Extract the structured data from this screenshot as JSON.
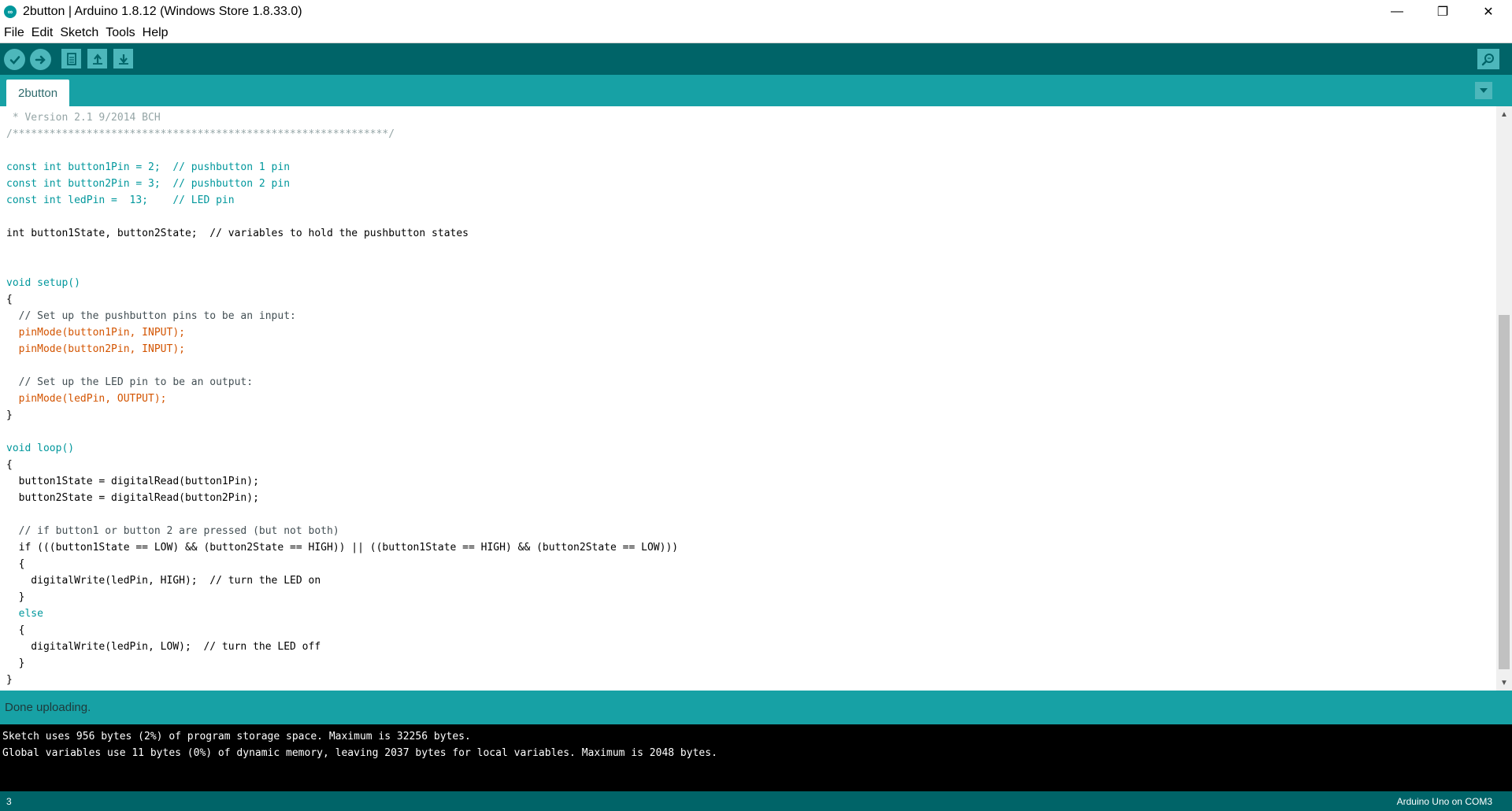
{
  "window": {
    "title": "2button | Arduino 1.8.12 (Windows Store 1.8.33.0)",
    "controls": {
      "minimize": "—",
      "maximize": "❐",
      "close": "✕"
    }
  },
  "menu": [
    "File",
    "Edit",
    "Sketch",
    "Tools",
    "Help"
  ],
  "toolbar": [
    "verify-icon",
    "upload-icon",
    "new-icon",
    "open-icon",
    "save-icon",
    "serial-monitor-icon"
  ],
  "tabs": [
    "2button"
  ],
  "editor": {
    "code": [
      " * Version 2.1 9/2014 BCH",
      "/*************************************************************/",
      "",
      "const int button1Pin = 2;  // pushbutton 1 pin",
      "const int button2Pin = 3;  // pushbutton 2 pin",
      "const int ledPin =  13;    // LED pin",
      "",
      "int button1State, button2State;  // variables to hold the pushbutton states",
      "",
      "",
      "void setup()",
      "{",
      "  // Set up the pushbutton pins to be an input:",
      "  pinMode(button1Pin, INPUT);",
      "  pinMode(button2Pin, INPUT);",
      "",
      "  // Set up the LED pin to be an output:",
      "  pinMode(ledPin, OUTPUT);",
      "}",
      "",
      "void loop()",
      "{",
      "  button1State = digitalRead(button1Pin);",
      "  button2State = digitalRead(button2Pin);",
      "",
      "  // if button1 or button 2 are pressed (but not both)",
      "  if (((button1State == LOW) && (button2State == HIGH)) || ((button1State == HIGH) && (button2State == LOW)))",
      "  {",
      "    digitalWrite(ledPin, HIGH);  // turn the LED on",
      "  }",
      "  else",
      "  {",
      "    digitalWrite(ledPin, LOW);  // turn the LED off",
      "  }",
      "}"
    ]
  },
  "status": {
    "message": "Done uploading."
  },
  "console": {
    "lines": [
      "Sketch uses 956 bytes (2%) of program storage space. Maximum is 32256 bytes.",
      "Global variables use 11 bytes (0%) of dynamic memory, leaving 2037 bytes for local variables. Maximum is 2048 bytes."
    ]
  },
  "footer": {
    "line": "3",
    "board": "Arduino Uno on COM3"
  },
  "colors": {
    "toolbar": "#006468",
    "tabbar": "#17a1a5",
    "keyword": "#00979c",
    "function": "#d35400"
  }
}
